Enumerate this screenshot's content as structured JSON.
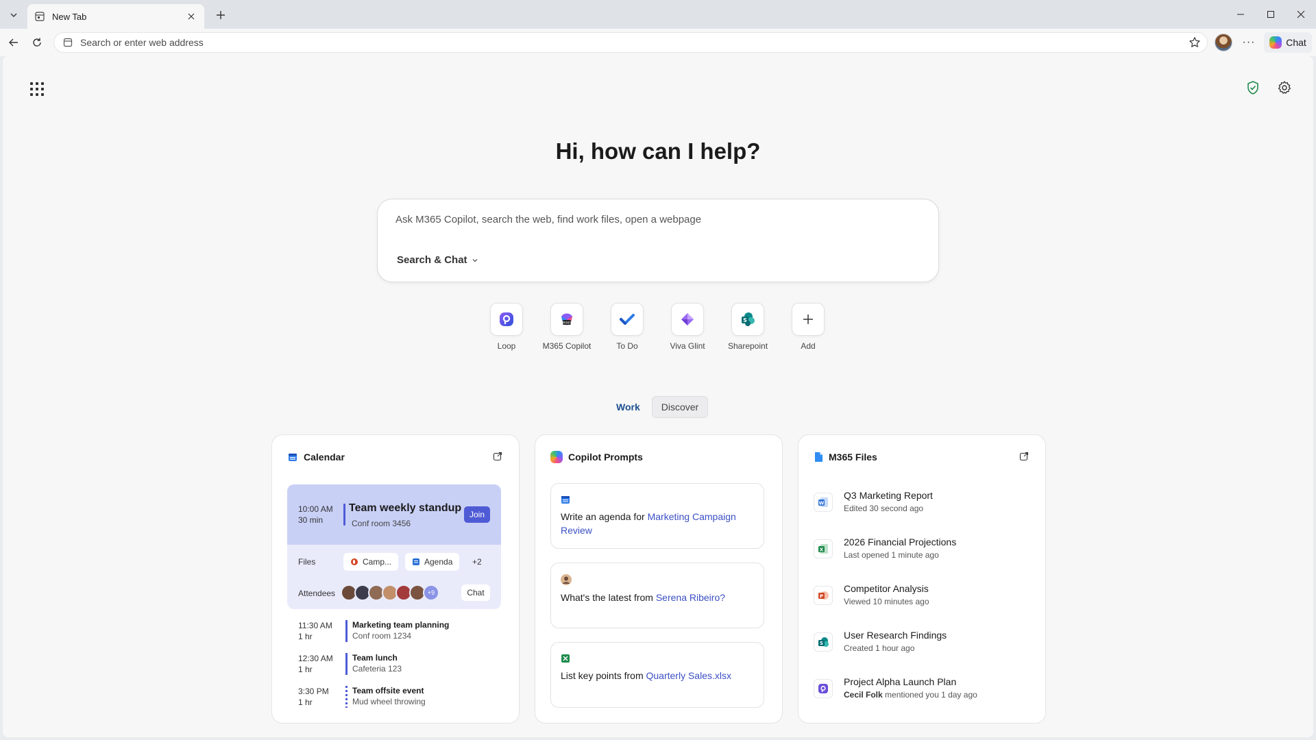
{
  "browser": {
    "tab_title": "New Tab",
    "address_placeholder": "Search or enter web address",
    "chat_label": "Chat",
    "more_label": "···"
  },
  "hero": {
    "greeting": "Hi, how can I help?",
    "search_placeholder": "Ask M365 Copilot, search the web, find work files, open a webpage",
    "mode_label": "Search & Chat"
  },
  "apps": [
    {
      "label": "Loop",
      "icon": "loop-icon"
    },
    {
      "label": "M365 Copilot",
      "icon": "m365-copilot-icon"
    },
    {
      "label": "To Do",
      "icon": "todo-icon"
    },
    {
      "label": "Viva Glint",
      "icon": "viva-glint-icon"
    },
    {
      "label": "Sharepoint",
      "icon": "sharepoint-icon"
    },
    {
      "label": "Add",
      "icon": "plus-icon"
    }
  ],
  "feed_tabs": {
    "work": "Work",
    "discover": "Discover"
  },
  "calendar": {
    "title": "Calendar",
    "main_event": {
      "time": "10:00 AM",
      "duration": "30 min",
      "title": "Team weekly standup",
      "location": "Conf room 3456",
      "join_label": "Join",
      "files_label": "Files",
      "file1": "Camp...",
      "file2": "Agenda",
      "more_files": "+2",
      "attendees_label": "Attendees",
      "more_attendees": "+9",
      "chat_label": "Chat"
    },
    "events": [
      {
        "time": "11:30 AM",
        "duration": "1 hr",
        "name": "Marketing team planning",
        "location": "Conf room 1234"
      },
      {
        "time": "12:30 AM",
        "duration": "1 hr",
        "name": "Team lunch",
        "location": "Cafeteria 123"
      },
      {
        "time": "3:30 PM",
        "duration": "1 hr",
        "name": "Team offsite event",
        "location": "Mud wheel throwing"
      }
    ]
  },
  "prompts": {
    "title": "Copilot Prompts",
    "items": [
      {
        "prefix": "Write an agenda for ",
        "link": "Marketing Campaign Review",
        "suffix": ""
      },
      {
        "prefix": "What's the latest from ",
        "link": "Serena Ribeiro?",
        "suffix": ""
      },
      {
        "prefix": "List key points from ",
        "link": "Quarterly Sales.xlsx",
        "suffix": ""
      }
    ]
  },
  "files": {
    "title": "M365 Files",
    "items": [
      {
        "name": "Q3 Marketing Report",
        "meta": "Edited 30 second ago",
        "type": "word",
        "color": "#2b6fd6"
      },
      {
        "name": "2026 Financial Projections",
        "meta": "Last opened 1 minute ago",
        "type": "excel",
        "color": "#1f8a4c"
      },
      {
        "name": "Competitor Analysis",
        "meta": "Viewed 10 minutes ago",
        "type": "powerpoint",
        "color": "#d24726"
      },
      {
        "name": "User Research Findings",
        "meta": "Created 1 hour ago",
        "type": "sharepoint",
        "color": "#0b8a8a"
      },
      {
        "name": "Project Alpha Launch Plan",
        "meta_author": "Cecil Folk",
        "meta_rest": " mentioned you 1 day ago",
        "type": "loop",
        "color": "#6b4fd8"
      }
    ]
  },
  "colors": {
    "accent": "#4f5bd5",
    "link": "#3b4fc4",
    "work_tab": "#1d4f91"
  }
}
